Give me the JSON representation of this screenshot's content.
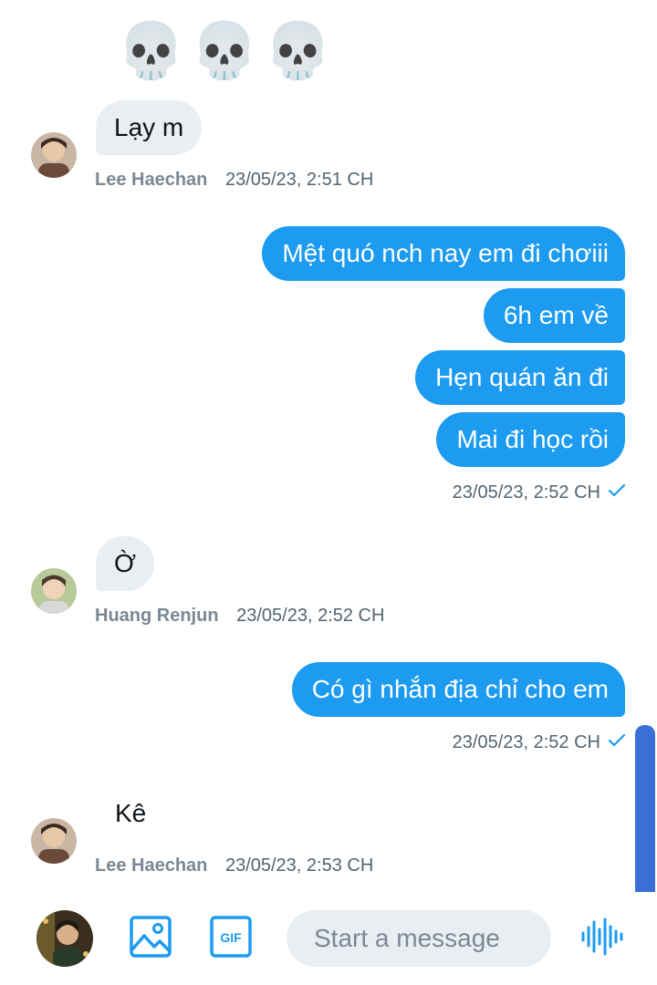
{
  "conversation": {
    "messages": [
      {
        "id": "m1",
        "text": "💀💀💀"
      },
      {
        "id": "m2",
        "text": "Lạy m",
        "sender": "Lee Haechan",
        "time": "23/05/23, 2:51 CH"
      },
      {
        "id": "m3",
        "text": "Mệt quó nch nay em đi chơiii"
      },
      {
        "id": "m4",
        "text": "6h em về"
      },
      {
        "id": "m5",
        "text": "Hẹn quán ăn đi"
      },
      {
        "id": "m6",
        "text": "Mai đi học rồi",
        "time": "23/05/23, 2:52 CH"
      },
      {
        "id": "m7",
        "text": "Ờ",
        "sender": "Huang Renjun",
        "time": "23/05/23, 2:52 CH"
      },
      {
        "id": "m8",
        "text": "Có gì nhắn địa chỉ cho em",
        "time": "23/05/23, 2:52 CH"
      },
      {
        "id": "m9",
        "text": "Kê",
        "sender": "Lee Haechan",
        "time": "23/05/23, 2:53 CH"
      }
    ]
  },
  "composer": {
    "placeholder": "Start a message",
    "icons": [
      "image-icon",
      "gif-icon",
      "voice-icon"
    ]
  },
  "colors": {
    "accent": "#1d9bf0",
    "incoming_bubble": "#e9eef2",
    "scrollbar": "#3a6fd8"
  }
}
